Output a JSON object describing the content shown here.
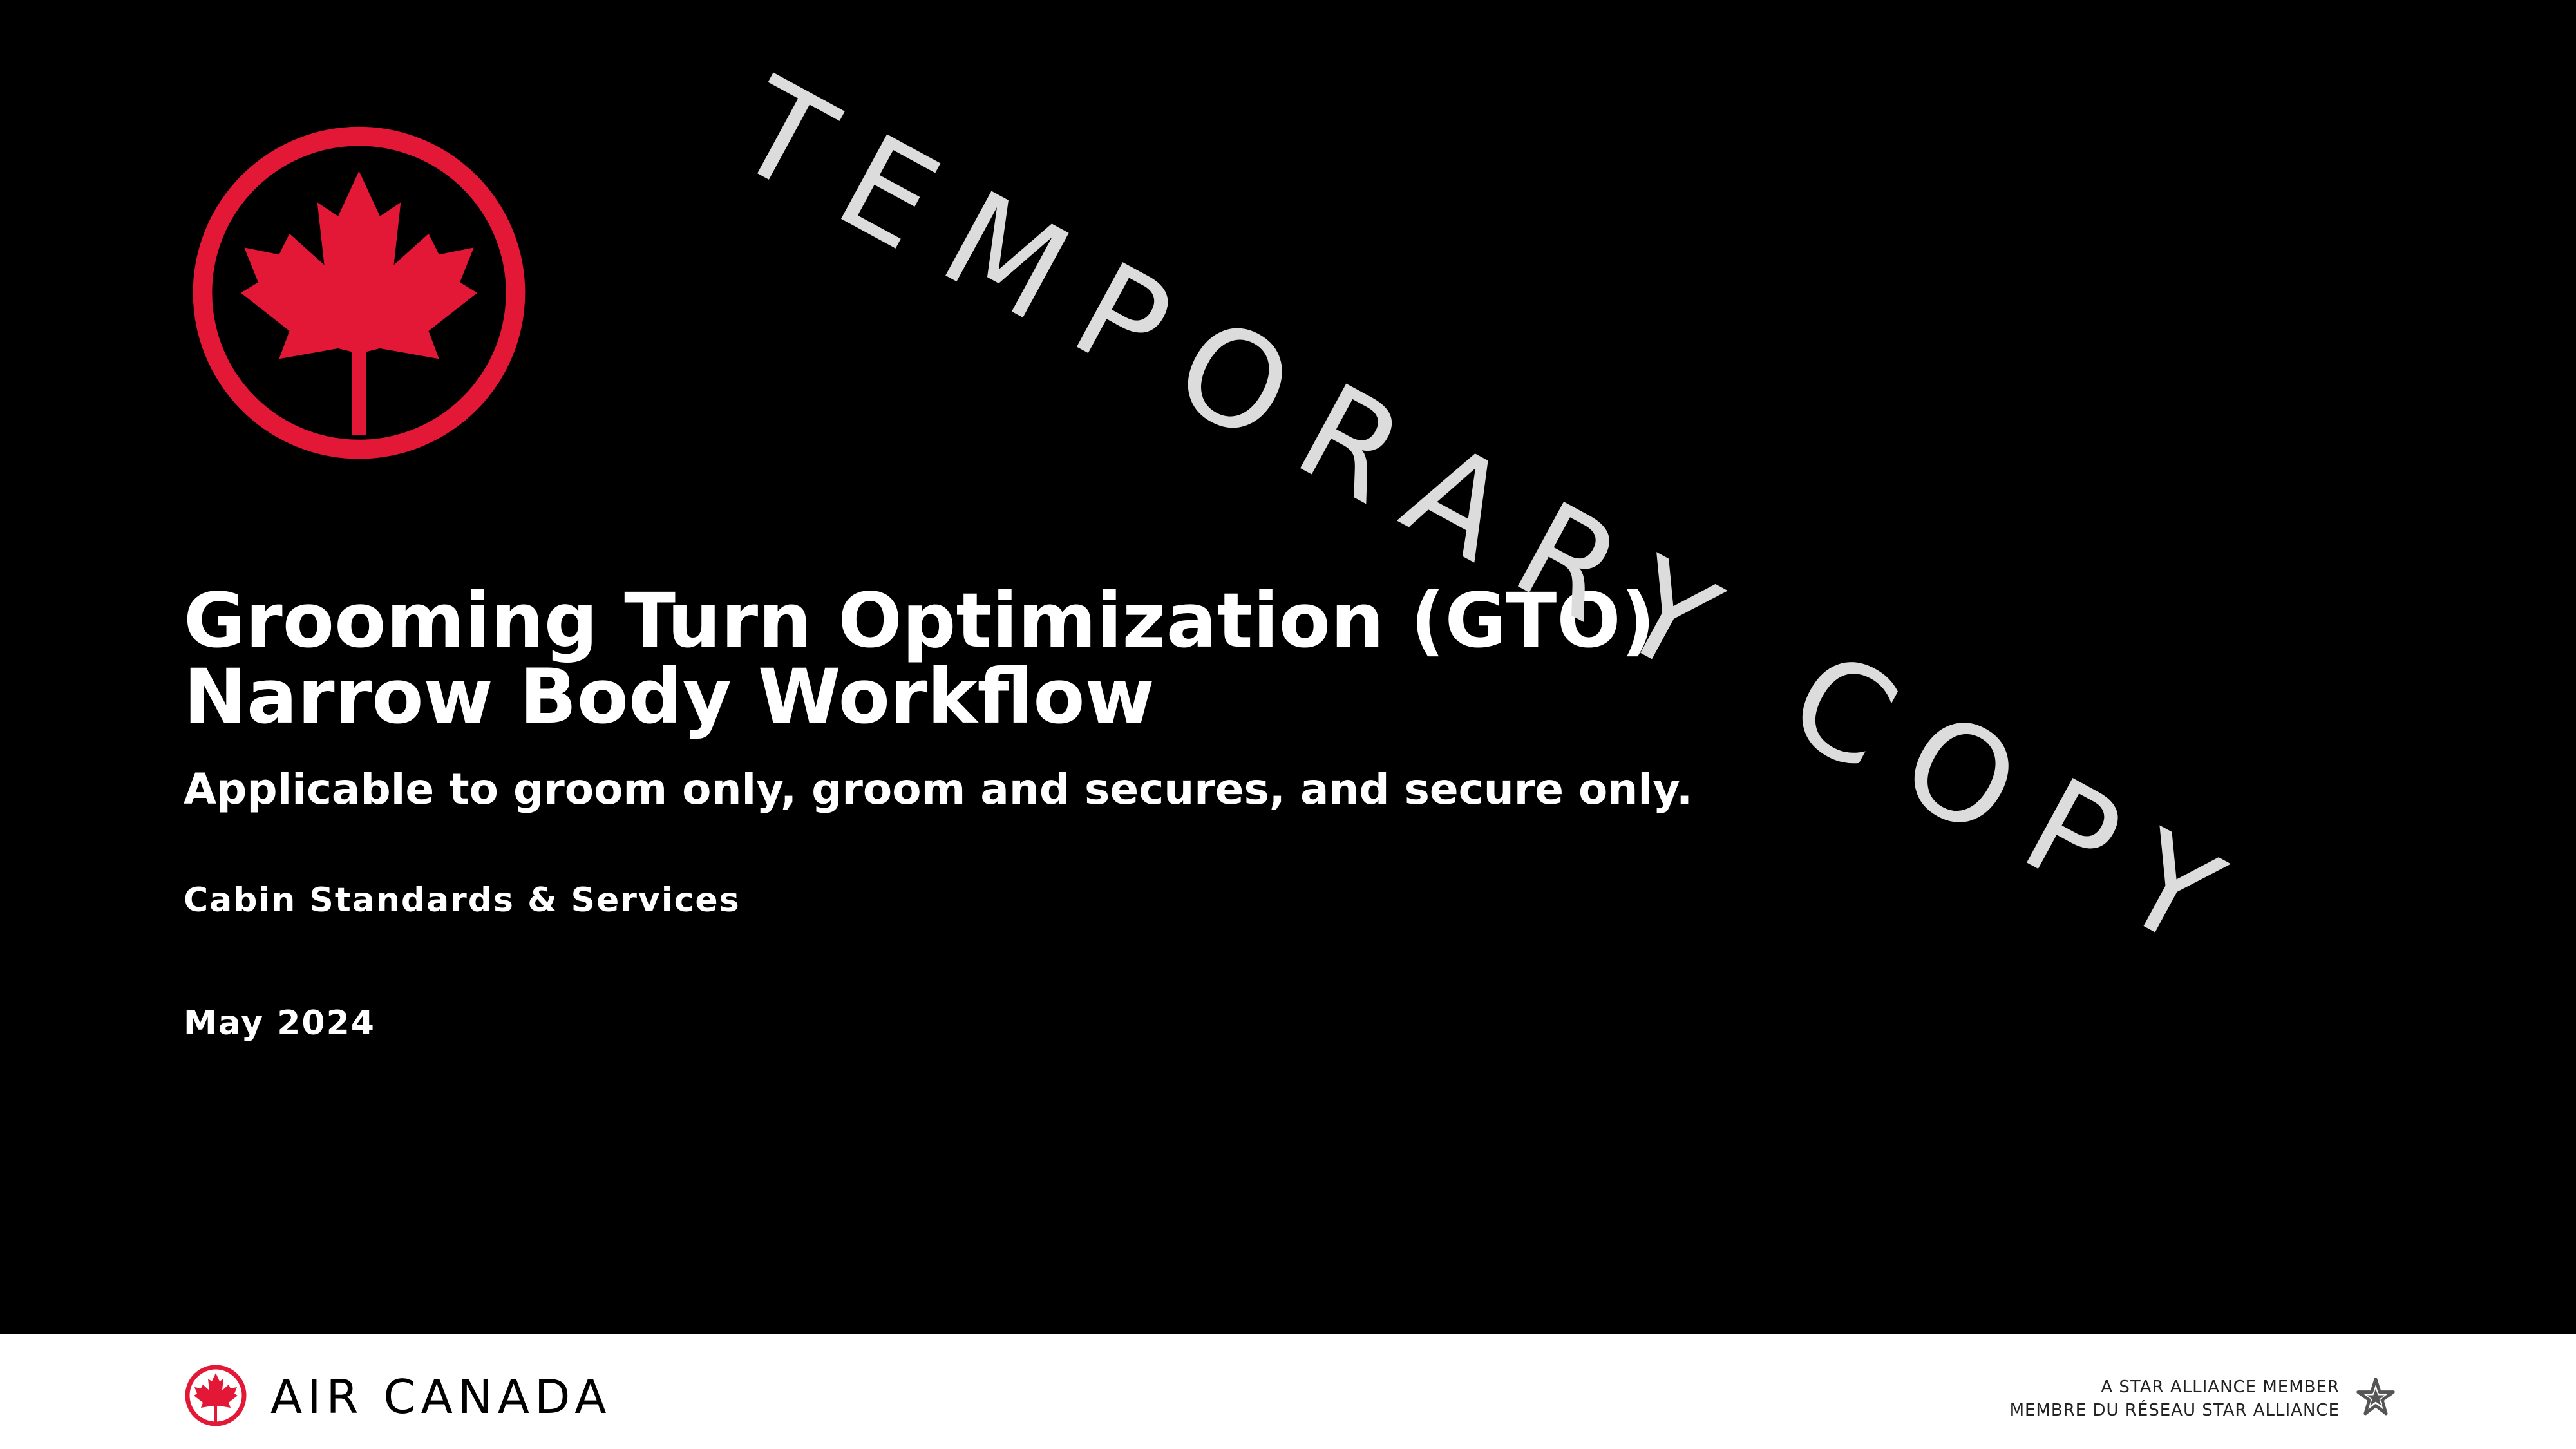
{
  "slide": {
    "title_line1": "Grooming Turn Optimization (GTO)",
    "title_line2": "Narrow Body Workflow",
    "subtitle": "Applicable to groom only, groom and secures, and secure only.",
    "department": "Cabin Standards & Services",
    "date": "May 2024",
    "watermark": "TEMPORARY COPY"
  },
  "footer": {
    "brand": "AIR CANADA",
    "alliance_line1": "A STAR ALLIANCE MEMBER",
    "alliance_line2": "MEMBRE DU RÉSEAU STAR ALLIANCE"
  },
  "colors": {
    "background": "#000000",
    "brand_red": "#e31837",
    "text": "#ffffff",
    "watermark": "#dcdcdc",
    "footer_bg": "#ffffff"
  },
  "icons": {
    "main_logo": "maple-leaf-roundel-icon",
    "footer_logo": "maple-leaf-roundel-icon",
    "alliance_logo": "star-alliance-icon"
  }
}
